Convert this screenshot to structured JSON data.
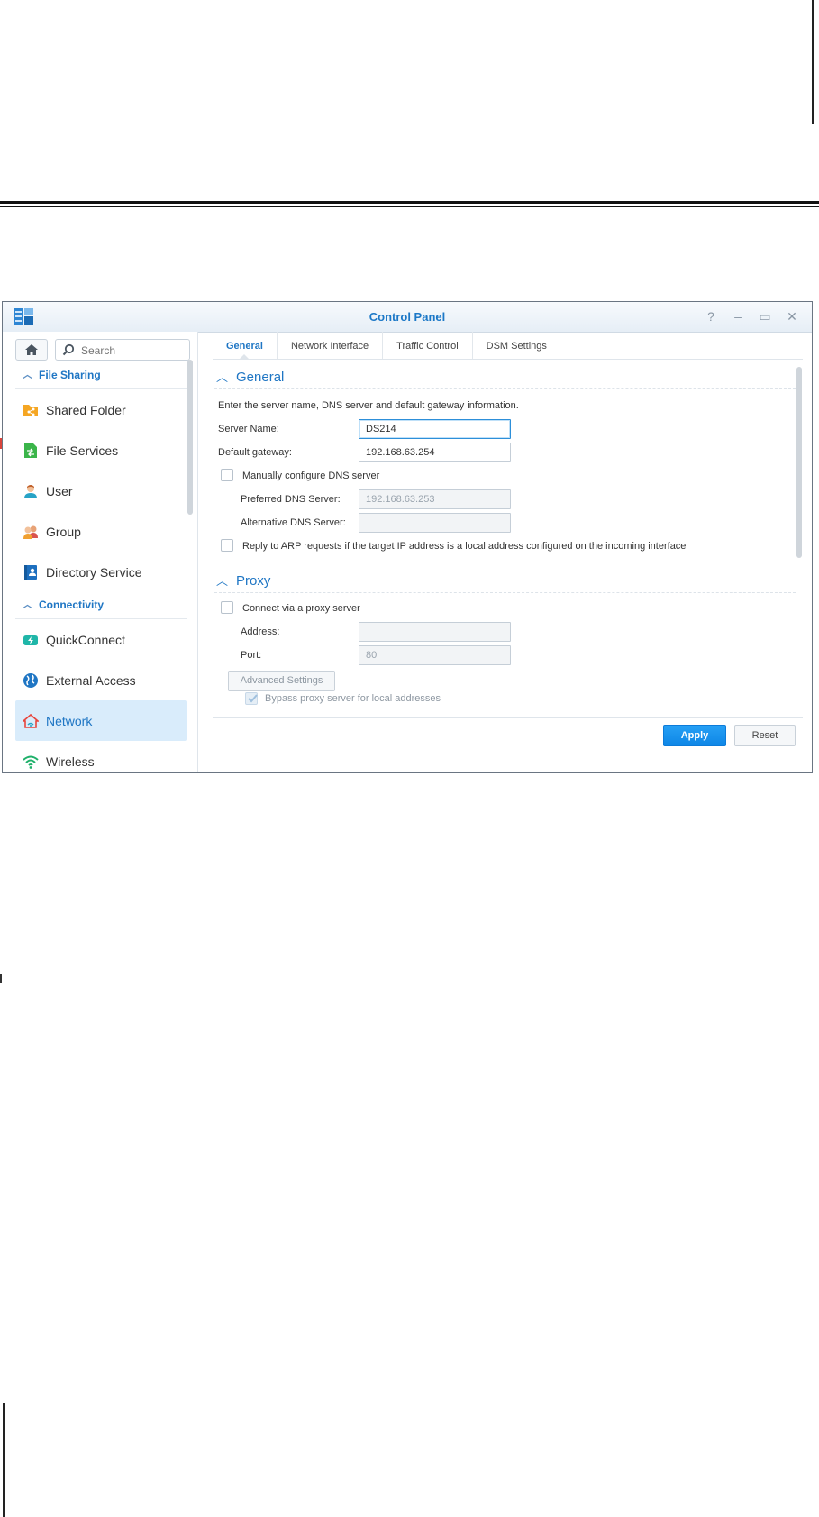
{
  "window": {
    "title": "Control Panel",
    "controls": {
      "help": "?",
      "minimize": "–",
      "maximize": "▭",
      "close": "✕"
    }
  },
  "sidebar": {
    "search": {
      "placeholder": "Search"
    },
    "categories": [
      {
        "label": "File Sharing",
        "items": [
          {
            "label": "Shared Folder",
            "icon": "shared-folder-icon"
          },
          {
            "label": "File Services",
            "icon": "file-services-icon"
          },
          {
            "label": "User",
            "icon": "user-icon"
          },
          {
            "label": "Group",
            "icon": "group-icon"
          },
          {
            "label": "Directory Service",
            "icon": "directory-service-icon"
          }
        ]
      },
      {
        "label": "Connectivity",
        "items": [
          {
            "label": "QuickConnect",
            "icon": "quickconnect-icon"
          },
          {
            "label": "External Access",
            "icon": "external-access-icon"
          },
          {
            "label": "Network",
            "icon": "network-icon",
            "active": true
          },
          {
            "label": "Wireless",
            "icon": "wireless-icon"
          }
        ]
      }
    ]
  },
  "tabs": [
    {
      "label": "General",
      "active": true
    },
    {
      "label": "Network Interface"
    },
    {
      "label": "Traffic Control"
    },
    {
      "label": "DSM Settings"
    }
  ],
  "general": {
    "title": "General",
    "description": "Enter the server name, DNS server and default gateway information.",
    "server_name_label": "Server Name:",
    "server_name_value": "DS214",
    "gateway_label": "Default gateway:",
    "gateway_value": "192.168.63.254",
    "manual_dns_label": "Manually configure DNS server",
    "preferred_dns_label": "Preferred DNS Server:",
    "preferred_dns_placeholder": "192.168.63.253",
    "alternative_dns_label": "Alternative DNS Server:",
    "alternative_dns_value": "",
    "arp_label": "Reply to ARP requests if the target IP address is a local address configured on the incoming interface"
  },
  "proxy": {
    "title": "Proxy",
    "connect_label": "Connect via a proxy server",
    "address_label": "Address:",
    "address_value": "",
    "port_label": "Port:",
    "port_value": "80",
    "advanced_label": "Advanced Settings",
    "bypass_label": "Bypass proxy server for local addresses"
  },
  "footer": {
    "apply_label": "Apply",
    "reset_label": "Reset"
  },
  "colors": {
    "accent": "#1f76c4",
    "apply": "#1a93ee",
    "active_item": "#d9ecfb"
  }
}
